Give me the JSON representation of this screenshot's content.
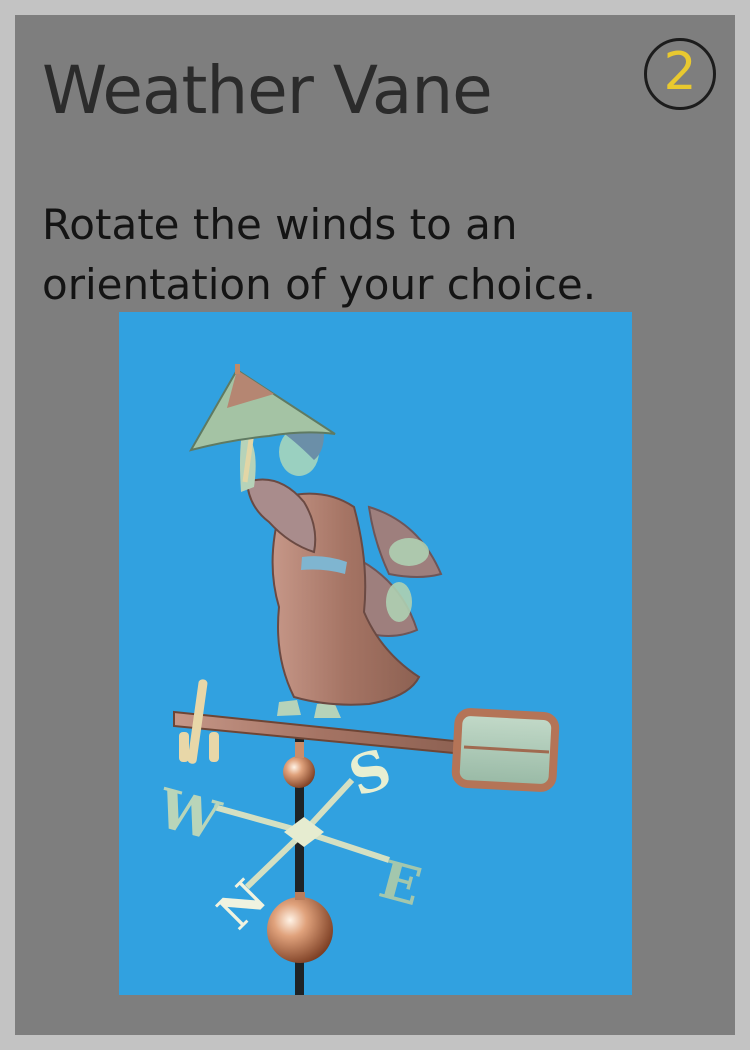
{
  "card": {
    "title": "Weather Vane",
    "cost": "2",
    "description_line1": "Rotate the winds to an",
    "description_line2": "orientation of your choice."
  },
  "compass_letters": {
    "west": "W",
    "north": "N",
    "south": "S",
    "east": "E"
  },
  "colors": {
    "card_background": "#7e7e7e",
    "border": "#c3c3c3",
    "sky": "#31a1e0",
    "cost_digit": "#e9c92f",
    "copper": "#a97a6a",
    "verdigris": "#a9cdb0"
  },
  "icons": {
    "cost_badge": "circle-number"
  }
}
